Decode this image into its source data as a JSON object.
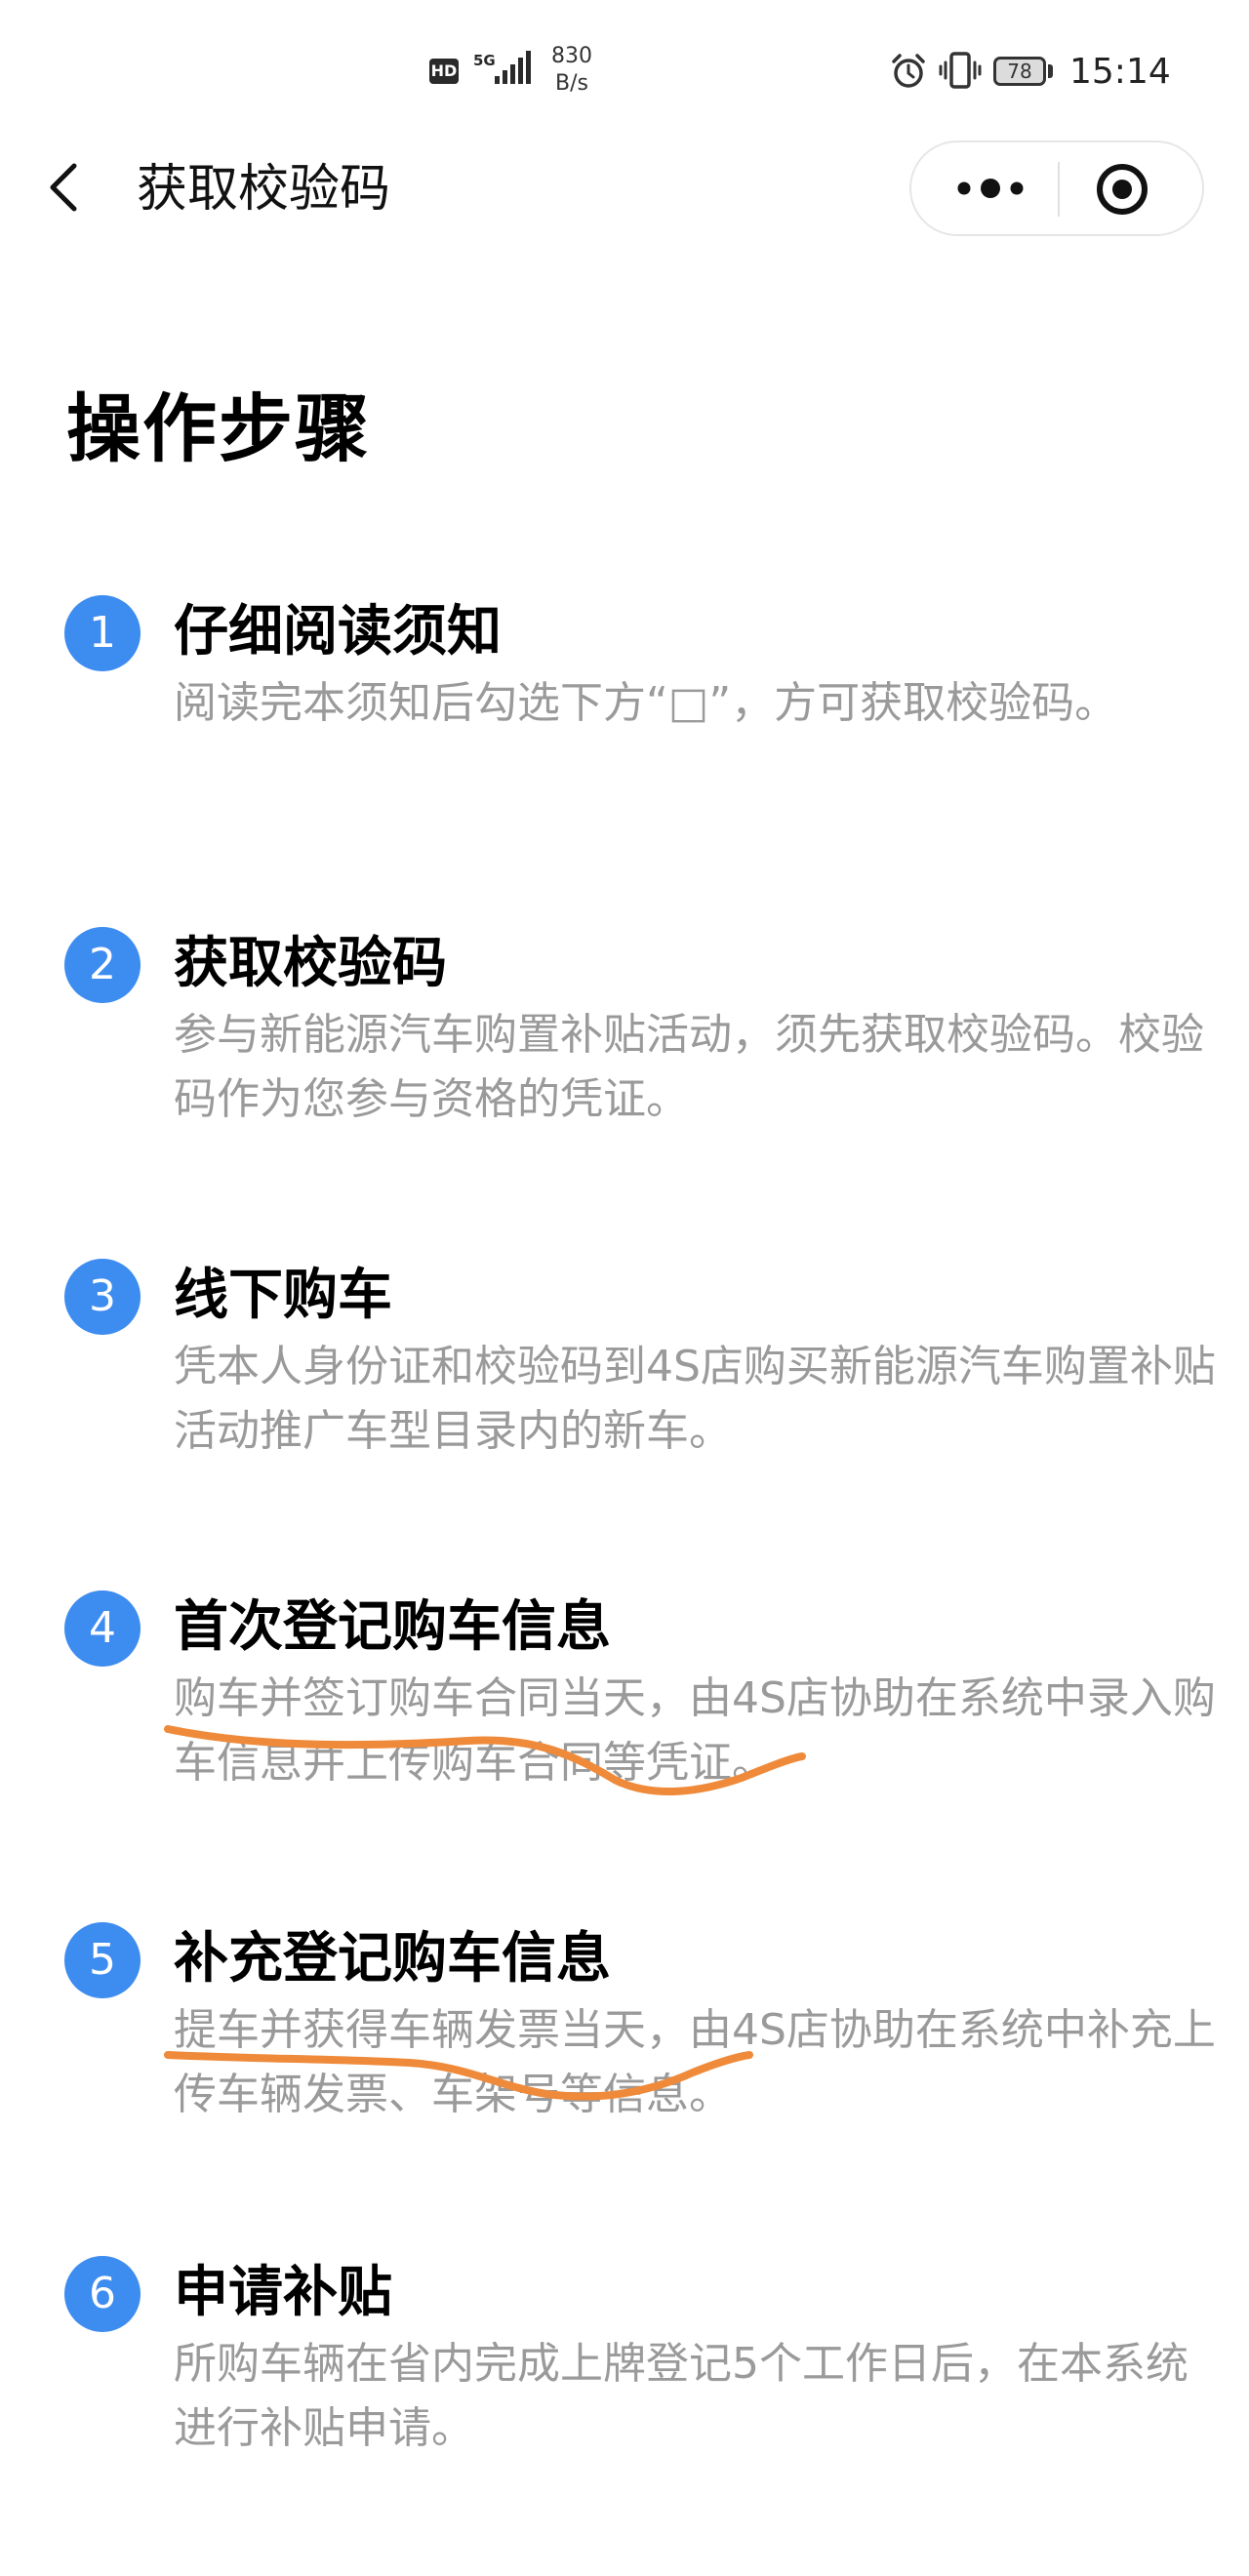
{
  "status_bar": {
    "hd": "HD",
    "network": "5G",
    "speed_value": "830",
    "speed_unit": "B/s",
    "battery": "78",
    "time": "15:14"
  },
  "nav": {
    "title": "获取校验码",
    "icons": [
      "chevron-left-icon",
      "more-dots-icon",
      "target-close-icon"
    ]
  },
  "section": {
    "title": "操作步骤"
  },
  "steps": [
    {
      "num": "1",
      "title": "仔细阅读须知",
      "desc": "阅读完本须知后勾选下方“□”，方可获取校验码。"
    },
    {
      "num": "2",
      "title": "获取校验码",
      "desc": "参与新能源汽车购置补贴活动，须先获取校验码。校验码作为您参与资格的凭证。"
    },
    {
      "num": "3",
      "title": "线下购车",
      "desc": "凭本人身份证和校验码到4S店购买新能源汽车购置补贴活动推广车型目录内的新车。"
    },
    {
      "num": "4",
      "title": "首次登记购车信息",
      "desc": "购车并签订购车合同当天，由4S店协助在系统中录入购车信息并上传购车合同等凭证。"
    },
    {
      "num": "5",
      "title": "补充登记购车信息",
      "desc": "提车并获得车辆发票当天，由4S店协助在系统中补充上传车辆发票、车架号等信息。"
    },
    {
      "num": "6",
      "title": "申请补贴",
      "desc": "所购车辆在省内完成上牌登记5个工作日后，在本系统进行补贴申请。"
    }
  ],
  "colors": {
    "step_badge": "#3d8cf0",
    "desc_text": "#9a9a9a",
    "annotation_stroke": "#ef8a3a"
  }
}
